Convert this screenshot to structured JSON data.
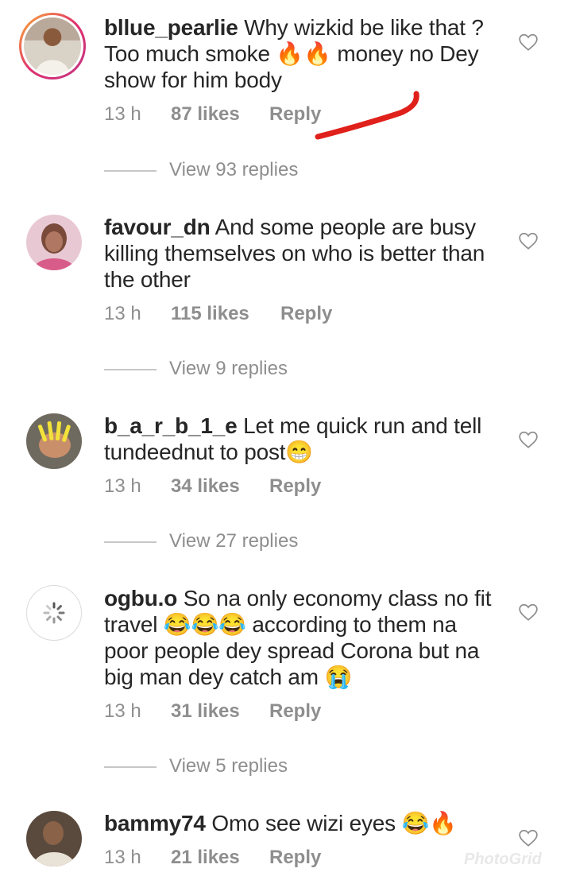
{
  "comments": [
    {
      "username": "bllue_pearlie",
      "text": "Why wizkid be like that ? Too much smoke 🔥🔥 money no Dey show for him body",
      "time": "13 h",
      "likes": "87 likes",
      "reply": "Reply",
      "view_replies": "View 93 replies"
    },
    {
      "username": "favour_dn",
      "text": "And some  people  are busy killing  themselves  on who is better than the other",
      "time": "13 h",
      "likes": "115 likes",
      "reply": "Reply",
      "view_replies": "View 9 replies"
    },
    {
      "username": "b_a_r_b_1_e",
      "text": "Let me quick run and tell tundeednut to post😁",
      "time": "13 h",
      "likes": "34 likes",
      "reply": "Reply",
      "view_replies": "View 27 replies"
    },
    {
      "username": "ogbu.o",
      "text": "So na only economy class no fit travel 😂😂😂 according to them na poor people dey spread Corona but na big man dey catch am 😭",
      "time": "13 h",
      "likes": "31 likes",
      "reply": "Reply",
      "view_replies": "View 5 replies"
    },
    {
      "username": "bammy74",
      "text": "Omo see wizi eyes 😂🔥",
      "time": "13 h",
      "likes": "21 likes",
      "reply": "Reply"
    }
  ],
  "watermark": "PhotoGrid",
  "colors": {
    "meta_gray": "#8e8e8e",
    "annotation_red": "#e0201b"
  }
}
